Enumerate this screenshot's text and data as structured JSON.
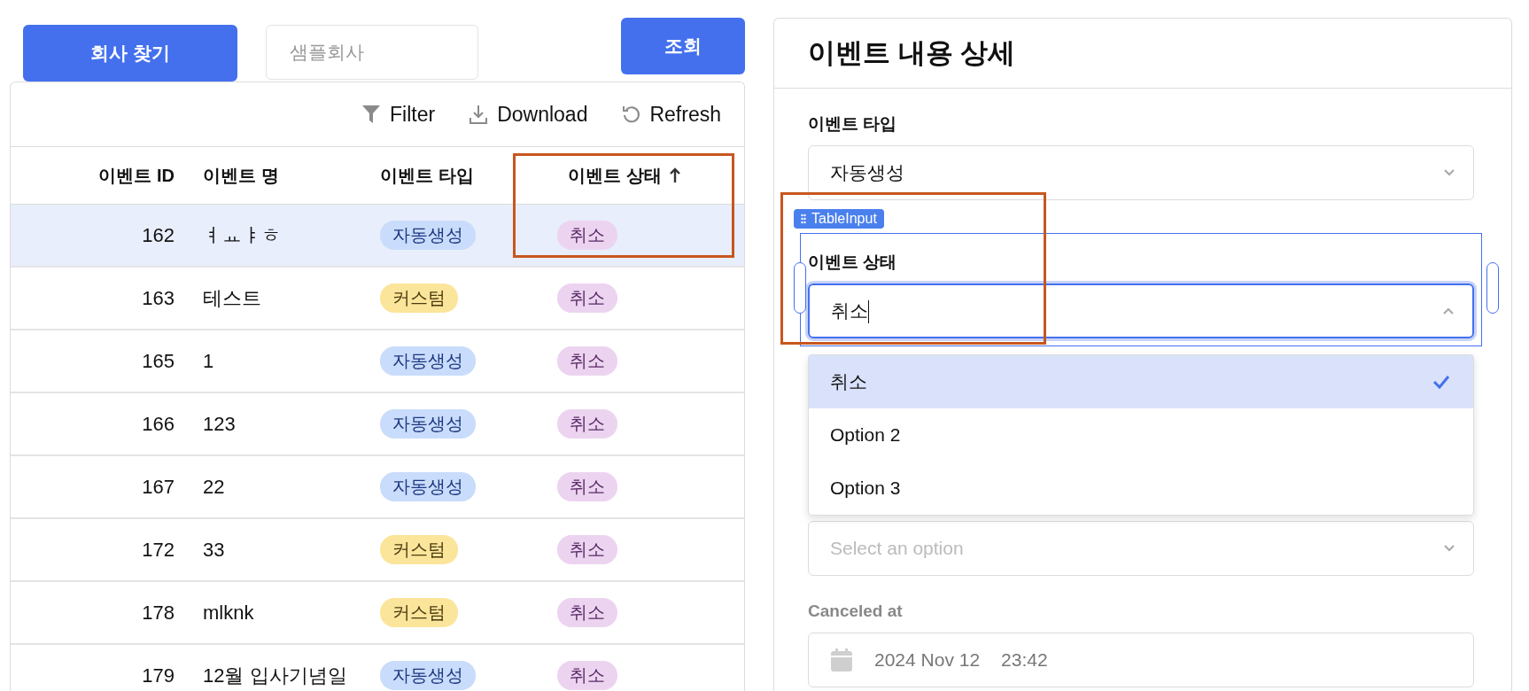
{
  "top_bar": {
    "find_company_button": "회사 찾기",
    "company_field": {
      "placeholder": "샘플회사"
    },
    "search_button": "조회"
  },
  "toolbar": [
    {
      "kind": "filter",
      "label": "Filter"
    },
    {
      "kind": "download",
      "label": "Download"
    },
    {
      "kind": "refresh",
      "label": "Refresh"
    }
  ],
  "table": {
    "columns": [
      {
        "label": "이벤트 ID",
        "sorted": false
      },
      {
        "label": "이벤트 명",
        "sorted": false
      },
      {
        "label": "이벤트 타입",
        "sorted": false
      },
      {
        "label": "이벤트 상태",
        "sorted": true
      }
    ],
    "rows": [
      {
        "id": "162",
        "name": "ㅕㅛㅑㅎ",
        "type": {
          "label": "자동생성",
          "kind": "auto"
        },
        "status": "취소",
        "selected": true
      },
      {
        "id": "163",
        "name": "테스트",
        "type": {
          "label": "커스텀",
          "kind": "custom"
        },
        "status": "취소",
        "selected": false
      },
      {
        "id": "165",
        "name": "1",
        "type": {
          "label": "자동생성",
          "kind": "auto"
        },
        "status": "취소",
        "selected": false
      },
      {
        "id": "166",
        "name": "123",
        "type": {
          "label": "자동생성",
          "kind": "auto"
        },
        "status": "취소",
        "selected": false
      },
      {
        "id": "167",
        "name": "22",
        "type": {
          "label": "자동생성",
          "kind": "auto"
        },
        "status": "취소",
        "selected": false
      },
      {
        "id": "172",
        "name": "33",
        "type": {
          "label": "커스텀",
          "kind": "custom"
        },
        "status": "취소",
        "selected": false
      },
      {
        "id": "178",
        "name": "mlknk",
        "type": {
          "label": "커스텀",
          "kind": "custom"
        },
        "status": "취소",
        "selected": false
      },
      {
        "id": "179",
        "name": "12월 입사기념일",
        "type": {
          "label": "자동생성",
          "kind": "auto"
        },
        "status": "취소",
        "selected": false
      }
    ]
  },
  "detail": {
    "title": "이벤트 내용 상세",
    "fields": [
      {
        "kind": "select",
        "label": "이벤트 타입",
        "value": "자동생성",
        "open": false
      },
      {
        "kind": "select",
        "label": "이벤트 상태",
        "value": "취소",
        "open": true,
        "component_tag": "TableInput",
        "options": [
          {
            "label": "취소",
            "selected": true
          },
          {
            "label": "Option 2",
            "selected": false
          },
          {
            "label": "Option 3",
            "selected": false
          }
        ]
      },
      {
        "kind": "select",
        "placeholder": "Select an option",
        "open": false
      },
      {
        "kind": "date",
        "label": "Canceled at",
        "disabled": true,
        "date": "2024 Nov 12",
        "time": "23:42"
      }
    ]
  }
}
